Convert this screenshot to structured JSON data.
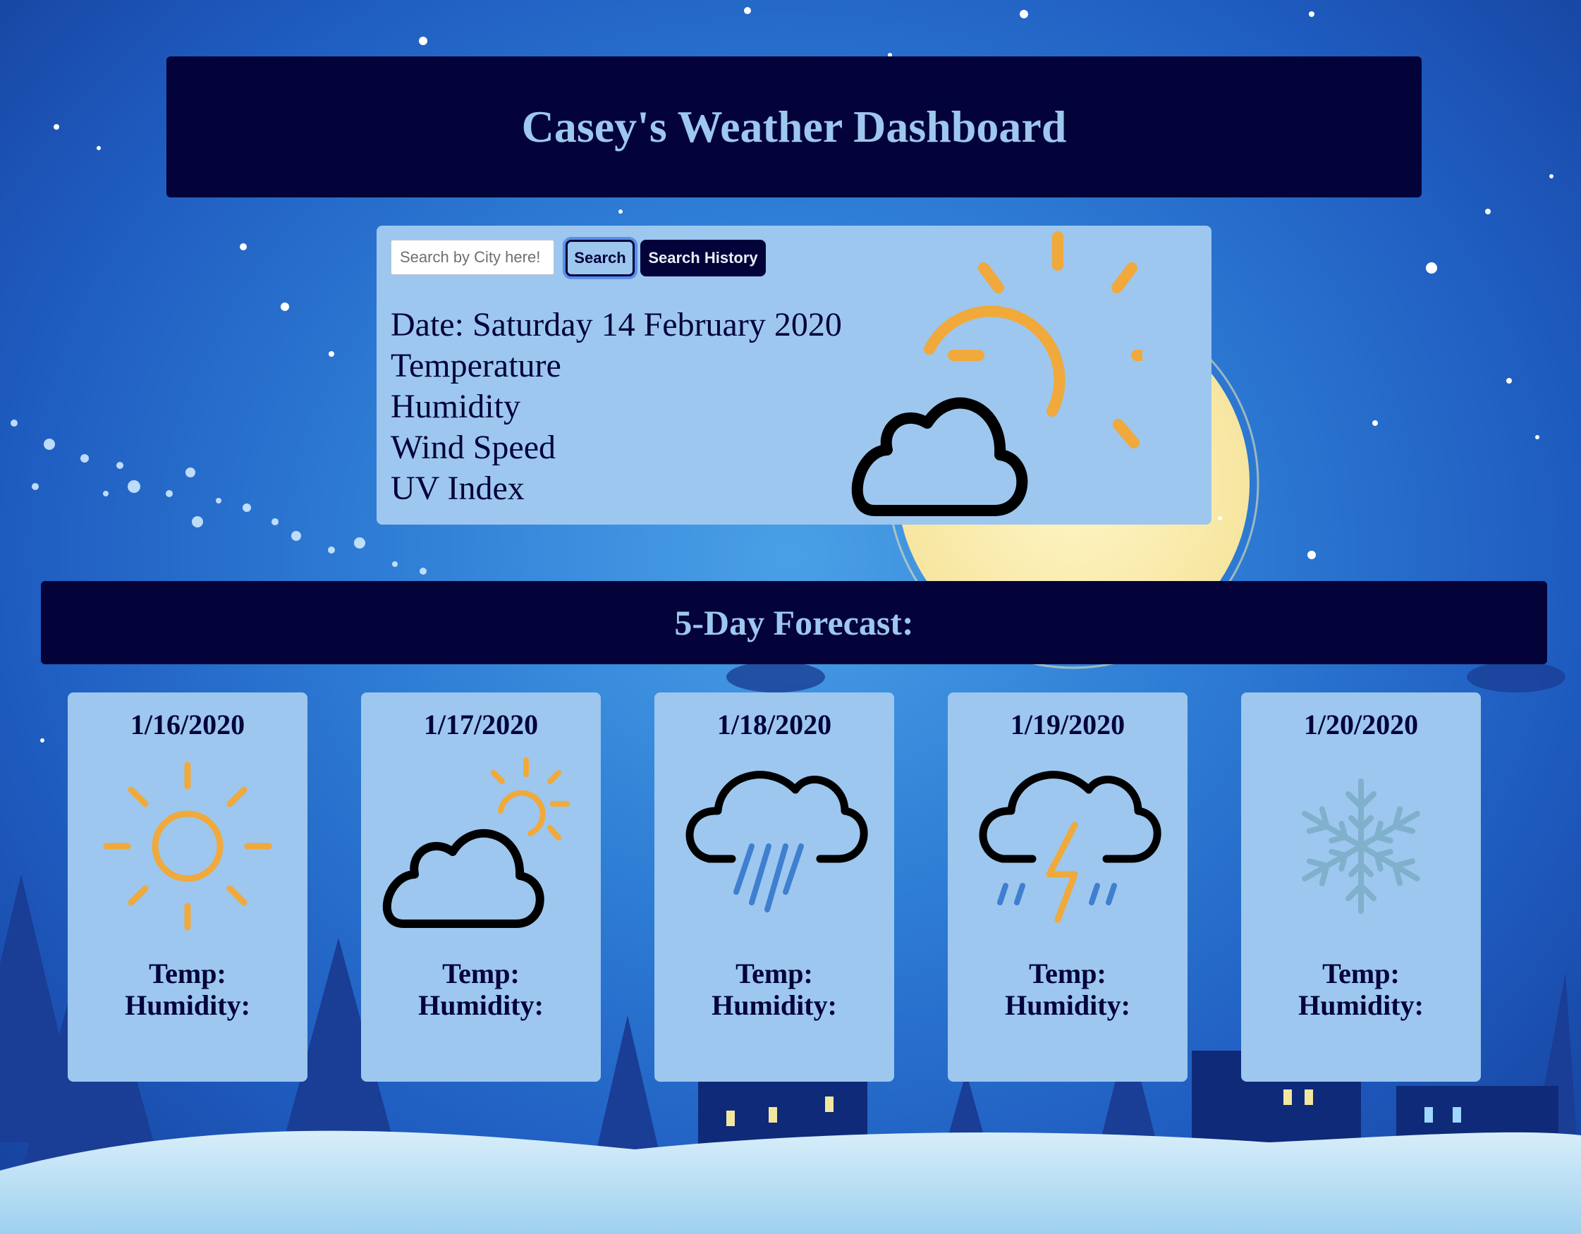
{
  "header": {
    "title": "Casey's Weather Dashboard"
  },
  "search": {
    "placeholder": "Search by City here!",
    "button_label": "Search",
    "history_label": "Search History"
  },
  "current": {
    "date_label": "Date: Saturday 14 February 2020",
    "temperature_label": "Temperature",
    "humidity_label": "Humidity",
    "wind_label": "Wind Speed",
    "uv_label": "UV Index",
    "icon": "partly-cloudy-icon"
  },
  "forecast": {
    "title": "5-Day Forecast:",
    "days": [
      {
        "date": "1/16/2020",
        "icon": "sun-icon",
        "temp_label": "Temp:",
        "humidity_label": "Humidity:"
      },
      {
        "date": "1/17/2020",
        "icon": "partly-cloudy-icon",
        "temp_label": "Temp:",
        "humidity_label": "Humidity:"
      },
      {
        "date": "1/18/2020",
        "icon": "rain-icon",
        "temp_label": "Temp:",
        "humidity_label": "Humidity:"
      },
      {
        "date": "1/19/2020",
        "icon": "thunderstorm-icon",
        "temp_label": "Temp:",
        "humidity_label": "Humidity:"
      },
      {
        "date": "1/20/2020",
        "icon": "snowflake-icon",
        "temp_label": "Temp:",
        "humidity_label": "Humidity:"
      }
    ]
  },
  "colors": {
    "navy": "#03033a",
    "panel": "#9dc7ee",
    "sun": "#f0a93a",
    "rain": "#3f7fd0",
    "snow": "#7fb0cc"
  }
}
